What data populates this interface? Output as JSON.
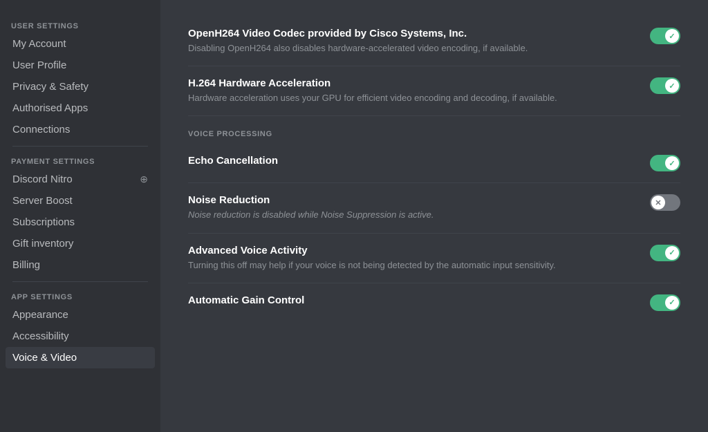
{
  "sidebar": {
    "user_settings_label": "USER SETTINGS",
    "payment_settings_label": "PAYMENT SETTINGS",
    "app_settings_label": "APP SETTINGS",
    "items": {
      "my_account": "My Account",
      "user_profile": "User Profile",
      "privacy_safety": "Privacy & Safety",
      "authorised_apps": "Authorised Apps",
      "connections": "Connections",
      "discord_nitro": "Discord Nitro",
      "server_boost": "Server Boost",
      "subscriptions": "Subscriptions",
      "gift_inventory": "Gift inventory",
      "billing": "Billing",
      "appearance": "Appearance",
      "accessibility": "Accessibility",
      "voice_video": "Voice & Video"
    }
  },
  "main": {
    "settings": [
      {
        "title": "OpenH264 Video Codec provided by Cisco Systems, Inc.",
        "desc": "Disabling OpenH264 also disables hardware-accelerated video encoding, if available.",
        "toggle": "on",
        "section": null
      },
      {
        "title": "H.264 Hardware Acceleration",
        "desc": "Hardware acceleration uses your GPU for efficient video encoding and decoding, if available.",
        "toggle": "on",
        "section": null
      },
      {
        "title": "Echo Cancellation",
        "desc": "",
        "toggle": "on",
        "section": "VOICE PROCESSING"
      },
      {
        "title": "Noise Reduction",
        "desc": "Noise reduction is disabled while Noise Suppression is active.",
        "toggle": "off",
        "section": null
      },
      {
        "title": "Advanced Voice Activity",
        "desc": "Turning this off may help if your voice is not being detected by the automatic input sensitivity.",
        "toggle": "on",
        "section": null
      },
      {
        "title": "Automatic Gain Control",
        "desc": "",
        "toggle": "on",
        "section": null
      }
    ]
  }
}
